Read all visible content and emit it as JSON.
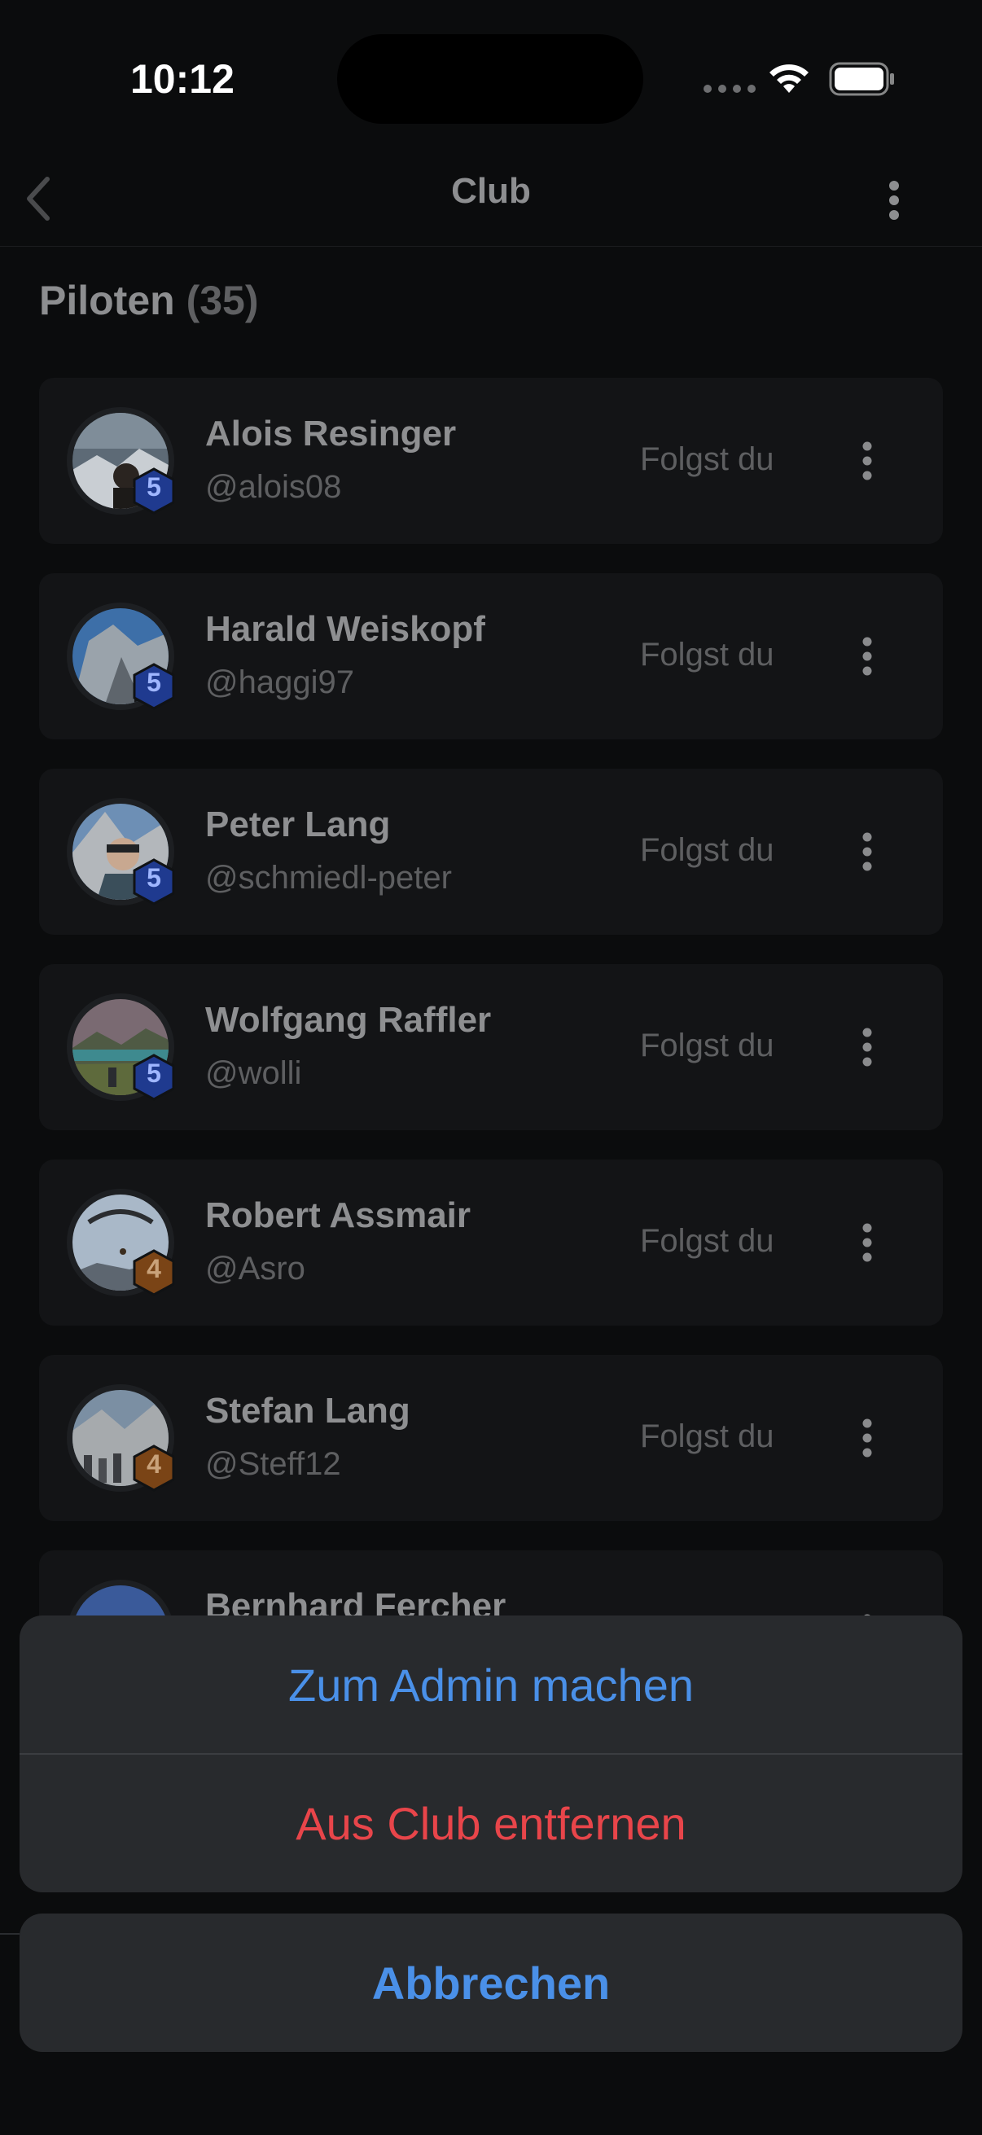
{
  "status_bar": {
    "time": "10:12"
  },
  "nav": {
    "title": "Club"
  },
  "section": {
    "title": "Piloten",
    "count": "(35)"
  },
  "members": [
    {
      "name": "Alois Resinger",
      "handle": "@alois08",
      "status": "Folgst du",
      "level": "5",
      "level_tier": "blue"
    },
    {
      "name": "Harald Weiskopf",
      "handle": "@haggi97",
      "status": "Folgst du",
      "level": "5",
      "level_tier": "blue"
    },
    {
      "name": "Peter Lang",
      "handle": "@schmiedl-peter",
      "status": "Folgst du",
      "level": "5",
      "level_tier": "blue"
    },
    {
      "name": "Wolfgang Raffler",
      "handle": "@wolli",
      "status": "Folgst du",
      "level": "5",
      "level_tier": "blue"
    },
    {
      "name": "Robert Assmair",
      "handle": "@Asro",
      "status": "Folgst du",
      "level": "4",
      "level_tier": "bronze"
    },
    {
      "name": "Stefan Lang",
      "handle": "@Steff12",
      "status": "Folgst du",
      "level": "4",
      "level_tier": "bronze"
    },
    {
      "name": "Bernhard Fercher",
      "handle": "",
      "status": "",
      "level": "",
      "level_tier": "blue"
    }
  ],
  "action_sheet": {
    "make_admin_label": "Zum Admin machen",
    "remove_label": "Aus Club entfernen",
    "cancel_label": "Abbrechen"
  },
  "colors": {
    "background": "#0b0c0d",
    "card": "#131416",
    "sheet": "#282a2d",
    "accent_blue": "#4a90e8",
    "destructive_red": "#e8454a",
    "badge_blue": "#1f3a8f",
    "badge_bronze": "#7a4416"
  },
  "icons": [
    "back-chevron-icon",
    "more-vertical-icon",
    "wifi-icon",
    "battery-icon",
    "signal-icon"
  ]
}
